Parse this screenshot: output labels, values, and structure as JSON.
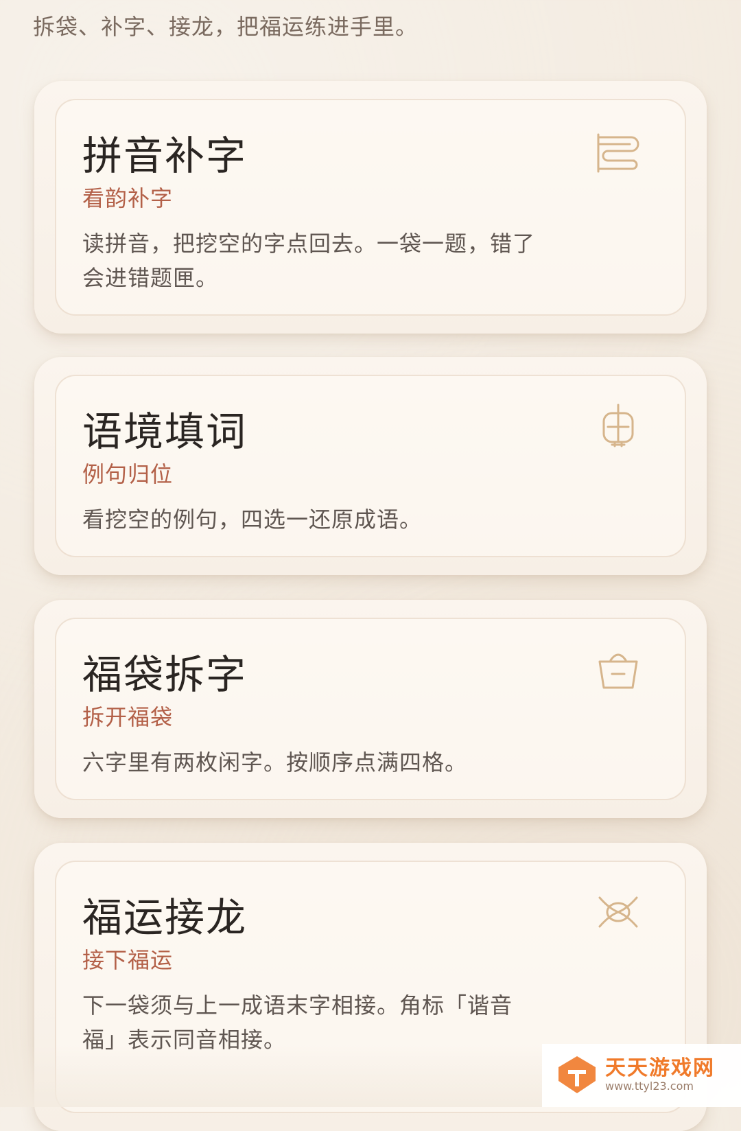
{
  "intro": "拆袋、补字、接龙，把福运练进手里。",
  "cards": [
    {
      "title": "拼音补字",
      "subtitle": "看韵补字",
      "description": "读拼音，把挖空的字点回去。一袋一题，错了会进错题匣。",
      "icon": "scroll-icon"
    },
    {
      "title": "语境填词",
      "subtitle": "例句归位",
      "description": "看挖空的例句，四选一还原成语。",
      "icon": "lantern-icon"
    },
    {
      "title": "福袋拆字",
      "subtitle": "拆开福袋",
      "description": "六字里有两枚闲字。按顺序点满四格。",
      "icon": "bag-icon"
    },
    {
      "title": "福运接龙",
      "subtitle": "接下福运",
      "description": "下一袋须与上一成语末字相接。角标「谐音福」表示同音相接。",
      "icon": "knot-icon"
    }
  ],
  "watermark": {
    "name": "天天游戏网",
    "url": "www.ttyl23.com"
  },
  "colors": {
    "background": "#f3ebe0",
    "card": "#fbf5ee",
    "title": "#2a2522",
    "accent": "#b36048",
    "icon": "#d6b58c"
  }
}
